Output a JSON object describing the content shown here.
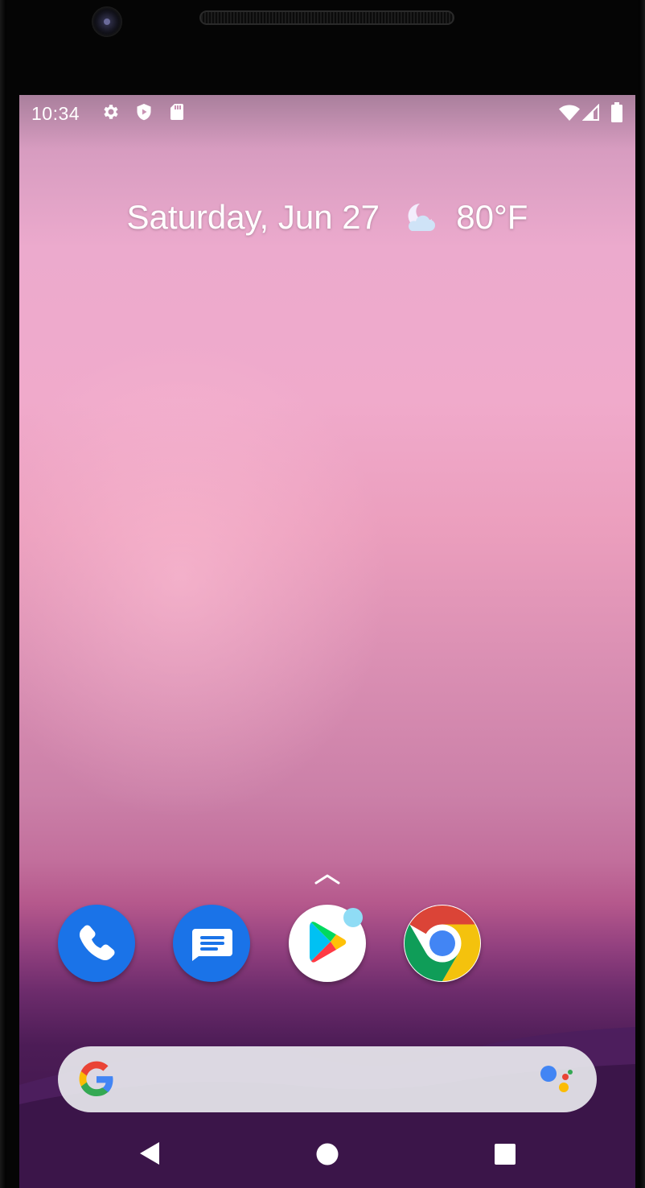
{
  "status_bar": {
    "time": "10:34",
    "left_icons": [
      "settings-icon",
      "shield-icon",
      "sd-card-icon"
    ],
    "right_icons": [
      "wifi-icon",
      "signal-icon",
      "battery-icon"
    ]
  },
  "date_widget": {
    "date": "Saturday, Jun 27",
    "weather_icon": "moon-cloud-icon",
    "temperature": "80°F"
  },
  "app_drawer_hint": "chevron-up-icon",
  "dock": {
    "apps": [
      {
        "name": "Phone",
        "icon": "phone-icon",
        "color": "#1a73e8"
      },
      {
        "name": "Messages",
        "icon": "messages-icon",
        "color": "#1a73e8"
      },
      {
        "name": "Play Store",
        "icon": "play-store-icon",
        "color": "#ffffff",
        "has_notification_dot": true
      },
      {
        "name": "Chrome",
        "icon": "chrome-icon",
        "color": "#ffffff"
      }
    ]
  },
  "search_bar": {
    "logo": "google-g-icon",
    "assistant": "google-assistant-icon"
  },
  "nav_bar": {
    "buttons": [
      "back-button",
      "home-button",
      "recents-button"
    ]
  },
  "colors": {
    "google_blue": "#4285f4",
    "google_red": "#ea4335",
    "google_yellow": "#fbbc05",
    "google_green": "#34a853"
  }
}
